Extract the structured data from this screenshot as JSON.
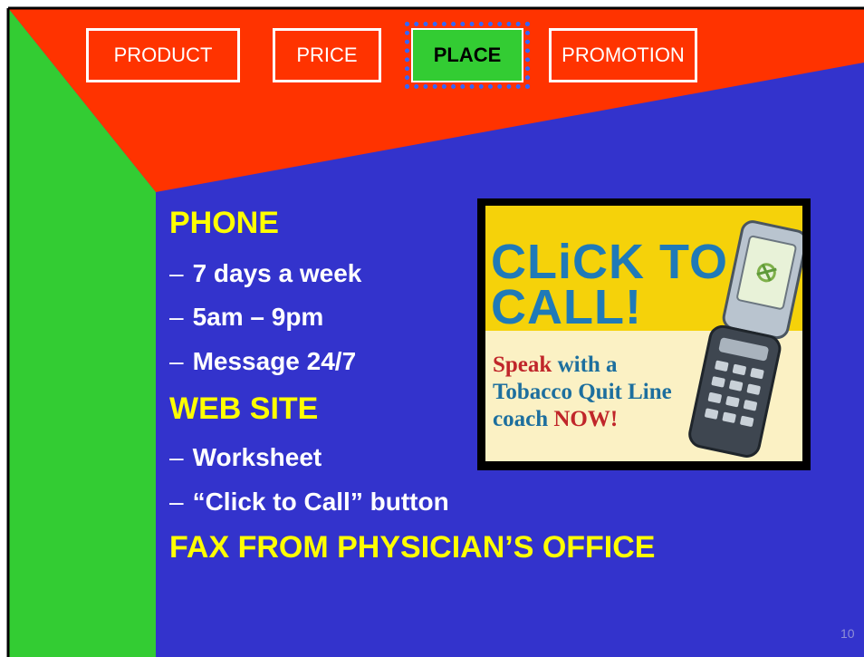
{
  "nav": {
    "tabs": [
      {
        "label": "PRODUCT",
        "active": false
      },
      {
        "label": "PRICE",
        "active": false
      },
      {
        "label": "PLACE",
        "active": true
      },
      {
        "label": "PROMOTION",
        "active": false
      }
    ]
  },
  "content": {
    "phone_heading": "PHONE",
    "phone_items": [
      "7 days a week",
      "5am – 9pm",
      "Message 24/7"
    ],
    "web_heading": "WEB SITE",
    "web_items": [
      "Worksheet",
      "“Click to Call” button"
    ],
    "fax_heading": "FAX FROM PHYSICIAN’S OFFICE",
    "bullet_dash": "–"
  },
  "ad": {
    "headline_line1": "CLiCK TO",
    "headline_line2": "CALL!",
    "sub_line1_red": "Speak",
    "sub_line1_rest": " with a",
    "sub_line2": "Tobacco Quit Line",
    "sub_line3_plain": "coach ",
    "sub_line3_red": "NOW!",
    "icon": "cell-phone-icon"
  },
  "page_number": "10",
  "colors": {
    "background_blue": "#3333cc",
    "header_red": "#ff3300",
    "side_green": "#33cc33",
    "heading_yellow": "#ffff00",
    "active_tab_green": "#33cc33"
  }
}
